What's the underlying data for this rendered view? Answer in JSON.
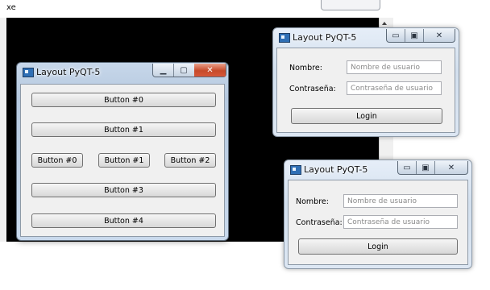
{
  "background_window": {
    "title": "xe"
  },
  "main_window": {
    "title": "Layout PyQT-5",
    "controls": {
      "minimize": "▁",
      "maximize": "▢",
      "close": "✕"
    },
    "buttons_top": [
      "Button #0",
      "Button #1"
    ],
    "buttons_row": [
      "Button #0",
      "Button #1",
      "Button #2"
    ],
    "buttons_bottom": [
      "Button #3",
      "Button #4"
    ]
  },
  "login_window_1": {
    "title": "Layout PyQT-5",
    "controls": {
      "minimize": "▭",
      "maximize": "▣",
      "close": "✕"
    },
    "name_label": "Nombre:",
    "name_placeholder": "Nombre de usuario",
    "password_label": "Contraseña:",
    "password_placeholder": "Contraseña de usuario",
    "login_label": "Login"
  },
  "login_window_2": {
    "title": "Layout PyQT-5",
    "controls": {
      "minimize": "▭",
      "maximize": "▣",
      "close": "✕"
    },
    "name_label": "Nombre:",
    "name_placeholder": "Nombre de usuario",
    "password_label": "Contraseña:",
    "password_placeholder": "Contraseña de usuario",
    "login_label": "Login"
  }
}
